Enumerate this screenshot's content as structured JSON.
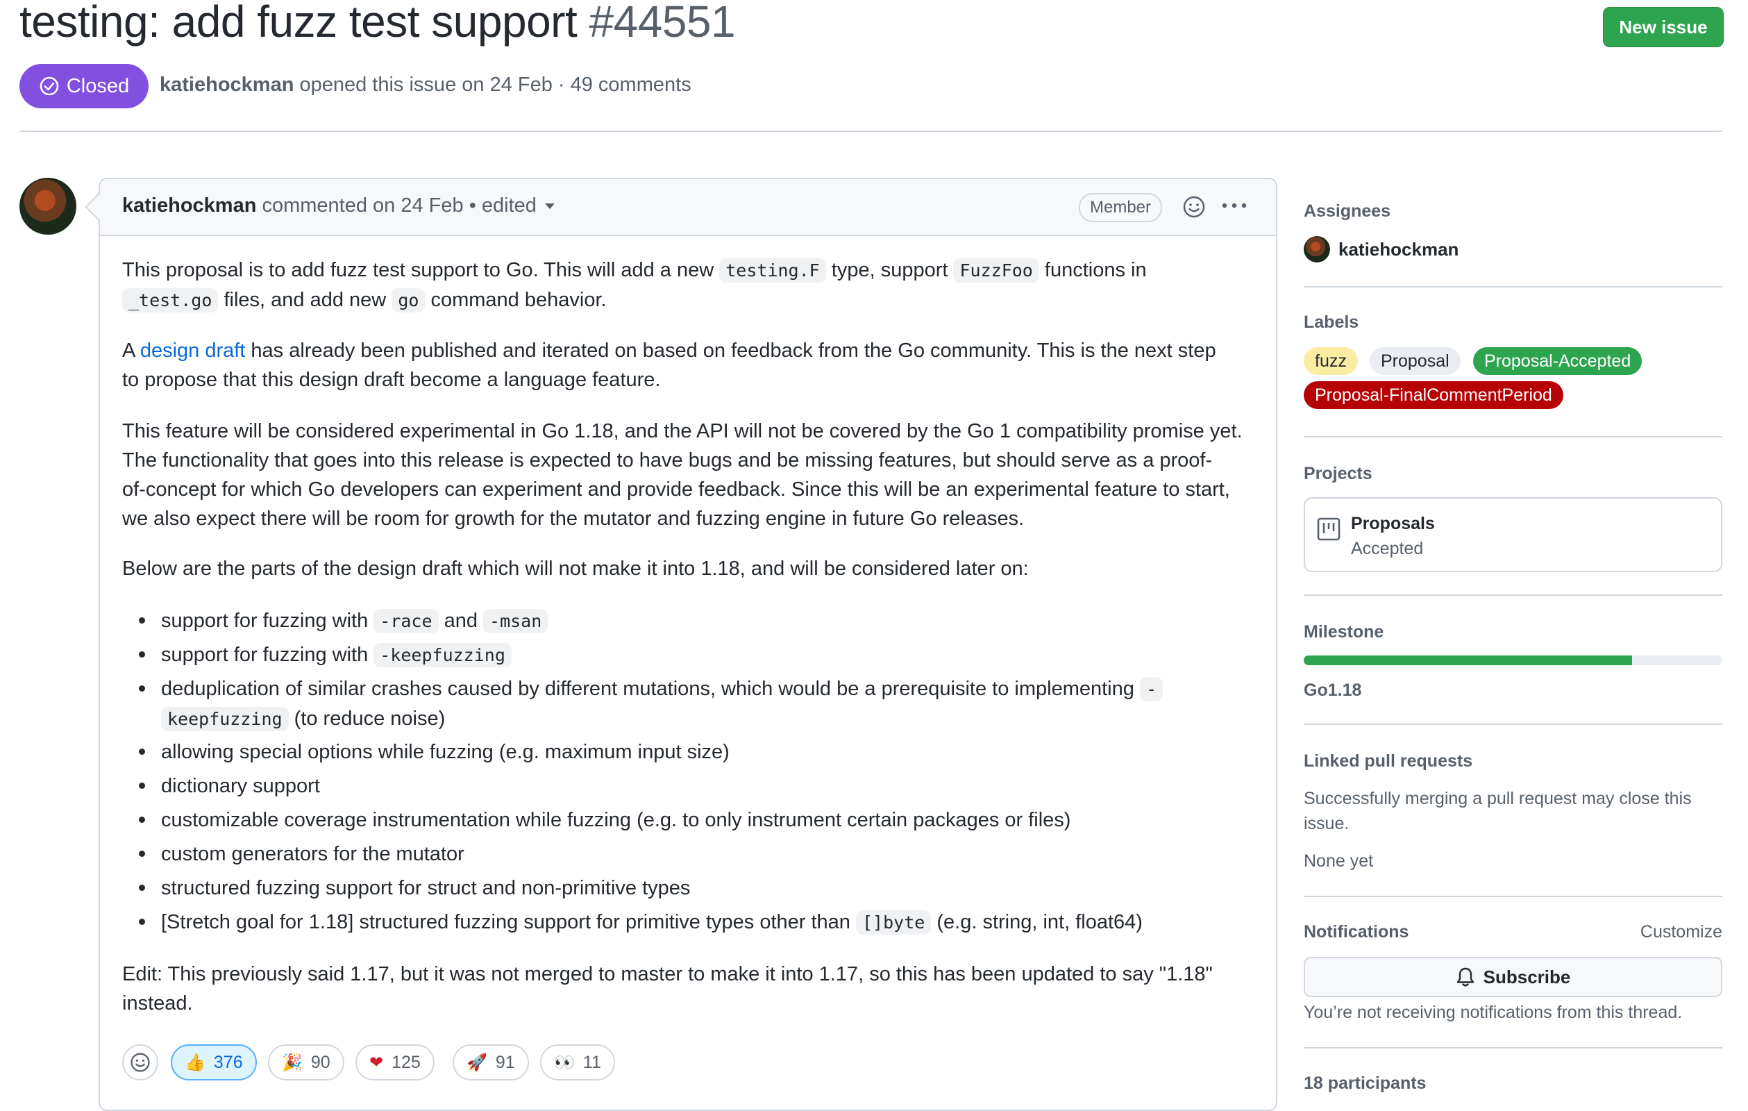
{
  "issue": {
    "title": "testing: add fuzz test support",
    "number": "#44551",
    "state": "Closed",
    "author": "katiehockman",
    "meta_text": " opened this issue on 24 Feb · 49 comments",
    "new_issue_label": "New issue"
  },
  "comment": {
    "author": "katiehockman",
    "meta": " commented on 24 Feb • edited",
    "badge": "Member",
    "body": {
      "p1_a": "This proposal is to add fuzz test support to Go. This will add a new ",
      "p1_code1": "testing.F",
      "p1_b": " type, support ",
      "p1_code2": "FuzzFoo",
      "p1_c": " functions in",
      "p1_code3": "_test.go",
      "p1_d": " files, and add new ",
      "p1_code4": "go",
      "p1_e": " command behavior.",
      "p2_a": "A ",
      "p2_link": "design draft",
      "p2_b": " has already been published and iterated on based on feedback from the Go community. This is the next step",
      "p2_c": "to propose that this design draft become a language feature.",
      "p3_l1": "This feature will be considered experimental in Go 1.18, and the API will not be covered by the Go 1 compatibility promise yet.",
      "p3_l2": "The functionality that goes into this release is expected to have bugs and be missing features, but should serve as a proof-",
      "p3_l3": "of-concept for which Go developers can experiment and provide feedback. Since this will be an experimental feature to start,",
      "p3_l4": "we also expect there will be room for growth for the mutator and fuzzing engine in future Go releases.",
      "p4": "Below are the parts of the design draft which will not make it into 1.18, and will be considered later on:",
      "b1_a": "support for fuzzing with ",
      "b1_code1": "-race",
      "b1_b": " and ",
      "b1_code2": "-msan",
      "b2_a": "support for fuzzing with ",
      "b2_code": "-keepfuzzing",
      "b3_a": "deduplication of similar crashes caused by different mutations, which would be a prerequisite to implementing ",
      "b3_code_a": "-",
      "b3_code_b": "keepfuzzing",
      "b3_b": " (to reduce noise)",
      "b4": "allowing special options while fuzzing (e.g. maximum input size)",
      "b5": "dictionary support",
      "b6": "customizable coverage instrumentation while fuzzing (e.g. to only instrument certain packages or files)",
      "b7": "custom generators for the mutator",
      "b8": "structured fuzzing support for struct and non-primitive types",
      "b9_a": "[Stretch goal for 1.18] structured fuzzing support for primitive types other than ",
      "b9_code": "[]byte",
      "b9_b": " (e.g. string, int, float64)",
      "p5_l1": "Edit: This previously said 1.17, but it was not merged to master to make it into 1.17, so this has been updated to say \"1.18\"",
      "p5_l2": "instead."
    },
    "reactions": [
      {
        "emoji": "👍",
        "count": "376"
      },
      {
        "emoji": "🎉",
        "count": "90"
      },
      {
        "emoji": "❤",
        "count": "125"
      },
      {
        "emoji": "🚀",
        "count": "91"
      },
      {
        "emoji": "👀",
        "count": "11"
      }
    ]
  },
  "sidebar": {
    "assignees": {
      "heading": "Assignees",
      "name": "katiehockman"
    },
    "labels": {
      "heading": "Labels",
      "items": [
        {
          "text": "fuzz",
          "bg": "#fbeca4",
          "fg": "#24292f"
        },
        {
          "text": "Proposal",
          "bg": "#eaeef2",
          "fg": "#24292f"
        },
        {
          "text": "Proposal-Accepted",
          "bg": "#2da44e",
          "fg": "#ffffff"
        },
        {
          "text": "Proposal-FinalCommentPeriod",
          "bg": "#b60205",
          "fg": "#ffffff"
        }
      ]
    },
    "projects": {
      "heading": "Projects",
      "name": "Proposals",
      "column": "Accepted"
    },
    "milestone": {
      "heading": "Milestone",
      "name": "Go1.18",
      "progress": 0.785
    },
    "linked_prs": {
      "heading": "Linked pull requests",
      "desc_l1": "Successfully merging a pull request may close this",
      "desc_l2": "issue.",
      "none": "None yet"
    },
    "notifications": {
      "heading": "Notifications",
      "customize": "Customize",
      "subscribe": "Subscribe",
      "note": "You’re not receiving notifications from this thread."
    },
    "participants": {
      "heading": "18 participants"
    }
  }
}
